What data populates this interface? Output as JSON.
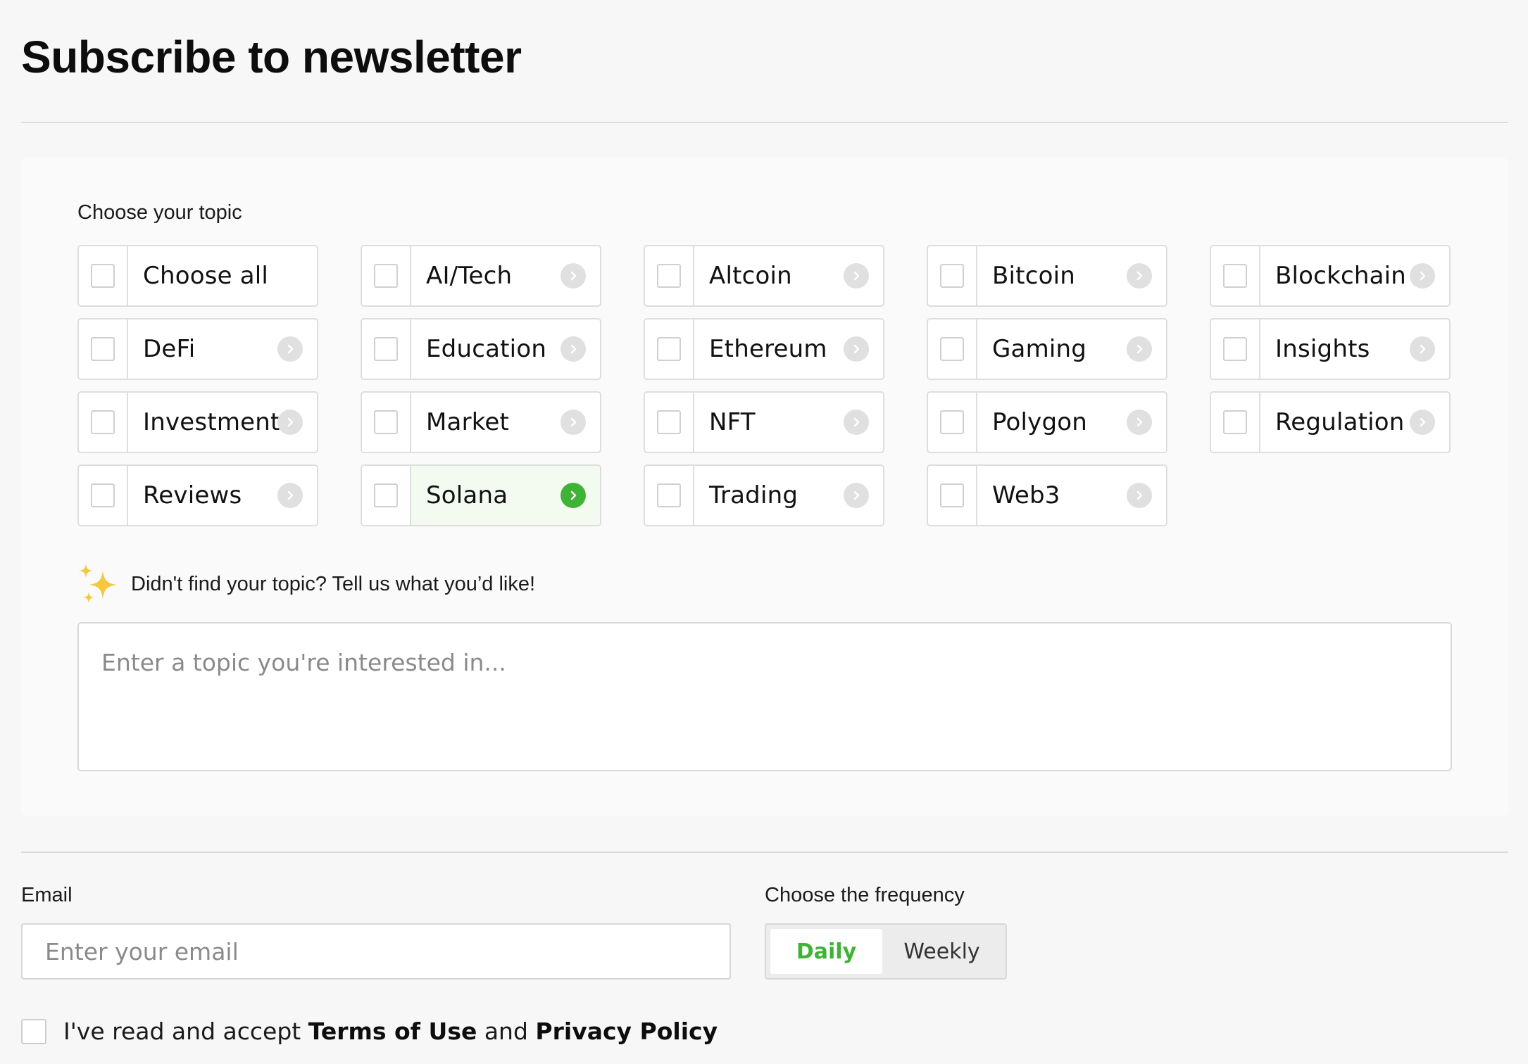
{
  "page": {
    "title": "Subscribe to newsletter"
  },
  "topics": {
    "heading": "Choose your topic",
    "items": [
      {
        "label": "Choose all",
        "has_arrow": false,
        "active": false
      },
      {
        "label": "AI/Tech",
        "has_arrow": true,
        "active": false
      },
      {
        "label": "Altcoin",
        "has_arrow": true,
        "active": false
      },
      {
        "label": "Bitcoin",
        "has_arrow": true,
        "active": false
      },
      {
        "label": "Blockchain",
        "has_arrow": true,
        "active": false
      },
      {
        "label": "DeFi",
        "has_arrow": true,
        "active": false
      },
      {
        "label": "Education",
        "has_arrow": true,
        "active": false
      },
      {
        "label": "Ethereum",
        "has_arrow": true,
        "active": false
      },
      {
        "label": "Gaming",
        "has_arrow": true,
        "active": false
      },
      {
        "label": "Insights",
        "has_arrow": true,
        "active": false
      },
      {
        "label": "Investment",
        "has_arrow": true,
        "active": false
      },
      {
        "label": "Market",
        "has_arrow": true,
        "active": false
      },
      {
        "label": "NFT",
        "has_arrow": true,
        "active": false
      },
      {
        "label": "Polygon",
        "has_arrow": true,
        "active": false
      },
      {
        "label": "Regulation",
        "has_arrow": true,
        "active": false
      },
      {
        "label": "Reviews",
        "has_arrow": true,
        "active": false
      },
      {
        "label": "Solana",
        "has_arrow": true,
        "active": true
      },
      {
        "label": "Trading",
        "has_arrow": true,
        "active": false
      },
      {
        "label": "Web3",
        "has_arrow": true,
        "active": false
      }
    ],
    "suggest_text": "Didn't find your topic? Tell us what you’d like!",
    "suggest_icon": "sparkles-icon",
    "suggest_placeholder": "Enter a topic you're interested in..."
  },
  "email": {
    "label": "Email",
    "placeholder": "Enter your email",
    "value": ""
  },
  "frequency": {
    "label": "Choose the frequency",
    "options": [
      "Daily",
      "Weekly"
    ],
    "selected": "Daily"
  },
  "terms": {
    "prefix": "I've read and accept ",
    "terms_link": "Terms of Use",
    "middle": " and ",
    "privacy_link": "Privacy Policy"
  },
  "colors": {
    "accent": "#3eb335",
    "active_chip_bg": "#f3fbf1",
    "border": "#dedede",
    "background": "#f7f7f7"
  }
}
